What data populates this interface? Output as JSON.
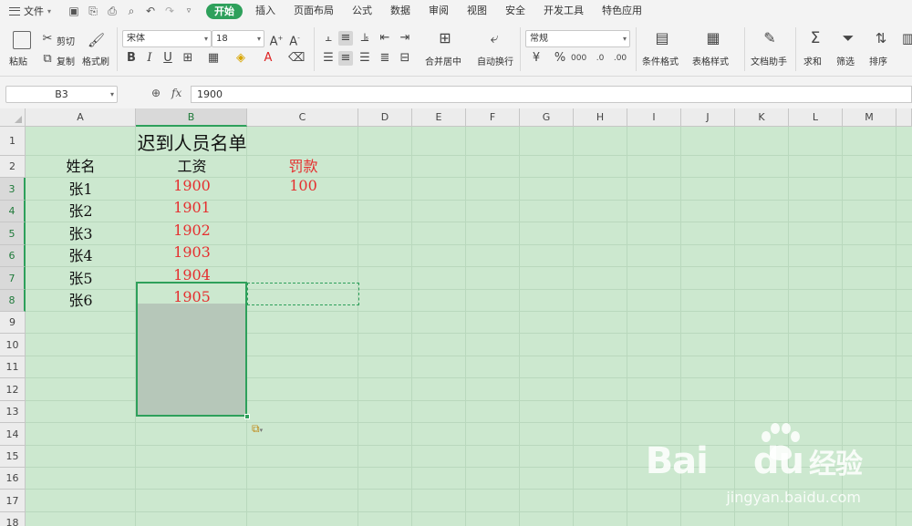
{
  "menubar": {
    "file_label": "文件",
    "tabs": [
      "开始",
      "插入",
      "页面布局",
      "公式",
      "数据",
      "审阅",
      "视图",
      "安全",
      "开发工具",
      "特色应用"
    ]
  },
  "ribbon": {
    "paste": "粘贴",
    "cut": "剪切",
    "copy": "复制",
    "format_painter": "格式刷",
    "font_name": "宋体",
    "font_size": "18",
    "number_format": "常规",
    "merge_center": "合并居中",
    "wrap_text": "自动换行",
    "conditional_format": "条件格式",
    "table_style": "表格样式",
    "doc_assistant": "文档助手",
    "sum": "求和",
    "filter": "筛选",
    "sort": "排序"
  },
  "formula_bar": {
    "name_box": "B3",
    "fx": "fx",
    "value": "1900"
  },
  "sheet": {
    "columns": [
      "A",
      "B",
      "C",
      "D",
      "E",
      "F",
      "G",
      "H",
      "I",
      "J",
      "K",
      "L",
      "M"
    ],
    "rows": [
      "1",
      "2",
      "3",
      "4",
      "5",
      "6",
      "7",
      "8",
      "9",
      "10",
      "11",
      "12",
      "13",
      "14",
      "15",
      "16",
      "17",
      "18"
    ],
    "title": "迟到人员名单",
    "header_name": "姓名",
    "header_salary": "工资",
    "header_fine": "罚款",
    "names": [
      "张1",
      "张2",
      "张3",
      "张4",
      "张5",
      "张6"
    ],
    "salaries": [
      "1900",
      "1901",
      "1902",
      "1903",
      "1904",
      "1905"
    ],
    "fine": "100"
  },
  "watermark": {
    "brand": "Bai",
    "brand2": "du",
    "cn": "经验",
    "url": "jingyan.baidu.com"
  },
  "colors": {
    "accent": "#2ea05b",
    "grid_bg": "#cce8cf",
    "red_text": "#e52f2f"
  }
}
